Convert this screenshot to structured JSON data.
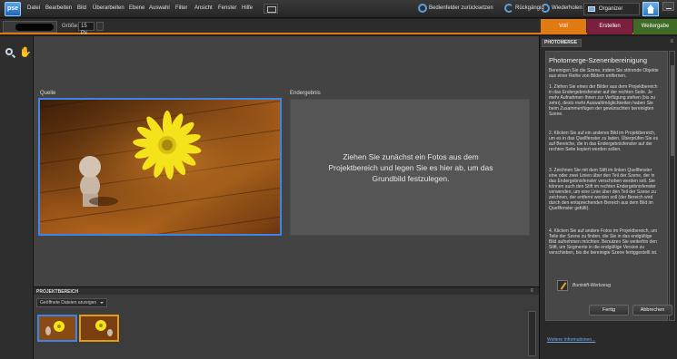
{
  "app": {
    "logo": "pse"
  },
  "menu": [
    "Datei",
    "Bearbeiten",
    "Bild",
    "Überarbeiten",
    "Ebene",
    "Auswahl",
    "Filter",
    "Ansicht",
    "Fenster",
    "Hilfe"
  ],
  "top_actions": {
    "reset_panels": "Bedienfelder zurücksetzen",
    "undo": "Rückgängig",
    "redo": "Wiederholen",
    "organizer": "Organizer"
  },
  "options": {
    "size_label": "Größe:",
    "size_value": "15 Px"
  },
  "mode_tabs": [
    {
      "label": "Voll",
      "color": "#e07a12"
    },
    {
      "label": "Erstellen",
      "color": "#7a1f3d"
    },
    {
      "label": "Weitergabe",
      "color": "#3f6b25"
    }
  ],
  "workspace": {
    "source_label": "Quelle",
    "result_label": "Endergebnis",
    "result_hint": "Ziehen Sie zunächst ein Fotos aus dem Projektbereich und legen Sie es hier ab, um das Grundbild festzulegen."
  },
  "bin": {
    "title": "PROJEKTBEREICH",
    "filter": "Geöffnete Dateien anzeigen"
  },
  "panel": {
    "tab": "PHOTOMERGE",
    "heading": "Photomerge-Szenenbereinigung",
    "intro": "Bereinigen Sie die Szene, indem Sie störende Objekte aus einer Reihe von Bildern entfernen.",
    "step1": "1. Ziehen Sie eines der Bilder aus dem Projektbereich in das Endergebnisfenster auf der rechten Seite. Je mehr Aufnahmen Ihnen zur Verfügung stehen (bis zu zehn), desto mehr Auswahlmöglichkeiten haben Sie beim Zusammenfügen der gewünschten bereinigten Szene.",
    "step2": "2. Klicken Sie auf ein anderes Bild im Projektbereich, um es in das Quellfenster zu laden. Überprüfen Sie es auf Bereiche, die in das Endergebnisfenster auf der rechten Seite kopiert werden sollen.",
    "step3": "3. Zeichnen Sie mit dem Stift im linken Quellfenster eine oder zwei Linien über den Teil der Szene, der in das Endergebnisfenster verschoben werden soll. Sie können auch den Stift im rechten Endergebnisfenster verwenden, um eine Linie über den Teil der Szene zu zeichnen, der entfernt werden soll (der Bereich wird durch den entsprechenden Bereich aus dem Bild im Quellfenster gefüllt).",
    "step4": "4. Klicken Sie auf andere Fotos im Projektbereich, um Teile der Szene zu finden, die Sie in das endgültige Bild aufnehmen möchten. Benutzen Sie weiterhin den Stift, um Segmente in die endgültige Version zu verschieben, bis die bereinigte Szene fertiggestellt ist.",
    "pencil_tool": "Buntstift-Werkzeug",
    "done": "Fertig",
    "cancel": "Abbrechen",
    "more_info": "Weitere Informationen..."
  }
}
